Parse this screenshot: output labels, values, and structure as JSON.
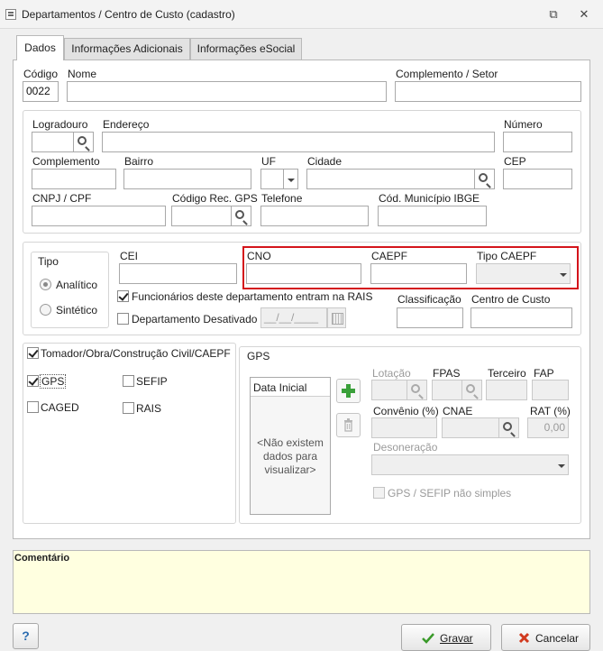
{
  "window": {
    "title": "Departamentos / Centro de Custo (cadastro)",
    "restore_glyph": "⧉",
    "close_glyph": "✕"
  },
  "tabs": [
    {
      "label": "Dados"
    },
    {
      "label": "Informações Adicionais"
    },
    {
      "label": "Informações eSocial"
    }
  ],
  "main": {
    "codigo_label": "Código",
    "codigo_value": "0022",
    "nome_label": "Nome",
    "nome_value": "",
    "complemento_setor_label": "Complemento / Setor",
    "complemento_setor_value": ""
  },
  "address": {
    "logradouro_label": "Logradouro",
    "endereco_label": "Endereço",
    "numero_label": "Número",
    "complemento_label": "Complemento",
    "bairro_label": "Bairro",
    "uf_label": "UF",
    "cidade_label": "Cidade",
    "cep_label": "CEP",
    "cnpj_label": "CNPJ / CPF",
    "codigo_rec_gps_label": "Código Rec. GPS",
    "telefone_label": "Telefone",
    "cod_municipio_label": "Cód. Município IBGE"
  },
  "tipo": {
    "group_label": "Tipo",
    "options": [
      {
        "label": "Analítico",
        "selected": true
      },
      {
        "label": "Sintético",
        "selected": false
      }
    ]
  },
  "ids": {
    "cei_label": "CEI",
    "cno_label": "CNO",
    "caepf_label": "CAEPF",
    "tipo_caepf_label": "Tipo CAEPF",
    "rais_check_label": "Funcionários deste departamento entram na RAIS",
    "rais_checked": true,
    "desativado_label": "Departamento Desativado",
    "desativado_checked": false,
    "date_placeholder": "__/__/____",
    "classificacao_label": "Classificação",
    "centro_custo_label": "Centro de Custo"
  },
  "tomador": {
    "label": "Tomador/Obra/Construção Civil/CAEPF",
    "checked": true,
    "gps_label": "GPS",
    "gps_checked": true,
    "sefip_label": "SEFIP",
    "sefip_checked": false,
    "caged_label": "CAGED",
    "caged_checked": false,
    "rais_label": "RAIS",
    "rais_checked": false
  },
  "gps": {
    "group_label": "GPS",
    "list_header": "Data Inicial",
    "empty_text": "<Não existem dados para visualizar>",
    "lotacao_label": "Lotação",
    "fpas_label": "FPAS",
    "terceiro_label": "Terceiro",
    "fap_label": "FAP",
    "convenio_label": "Convênio (%)",
    "cnae_label": "CNAE",
    "rat_label": "RAT (%)",
    "rat_value": "0,00",
    "desoneracao_label": "Desoneração",
    "nao_simples_label": "GPS / SEFIP não simples"
  },
  "comment": {
    "label": "Comentário",
    "value": ""
  },
  "footer": {
    "help_label": "?",
    "save_label": "Gravar",
    "cancel_label": "Cancelar"
  },
  "colors": {
    "highlight": "#d4141b",
    "comment_bg": "#ffffe0",
    "add_green": "#3aa03a"
  }
}
